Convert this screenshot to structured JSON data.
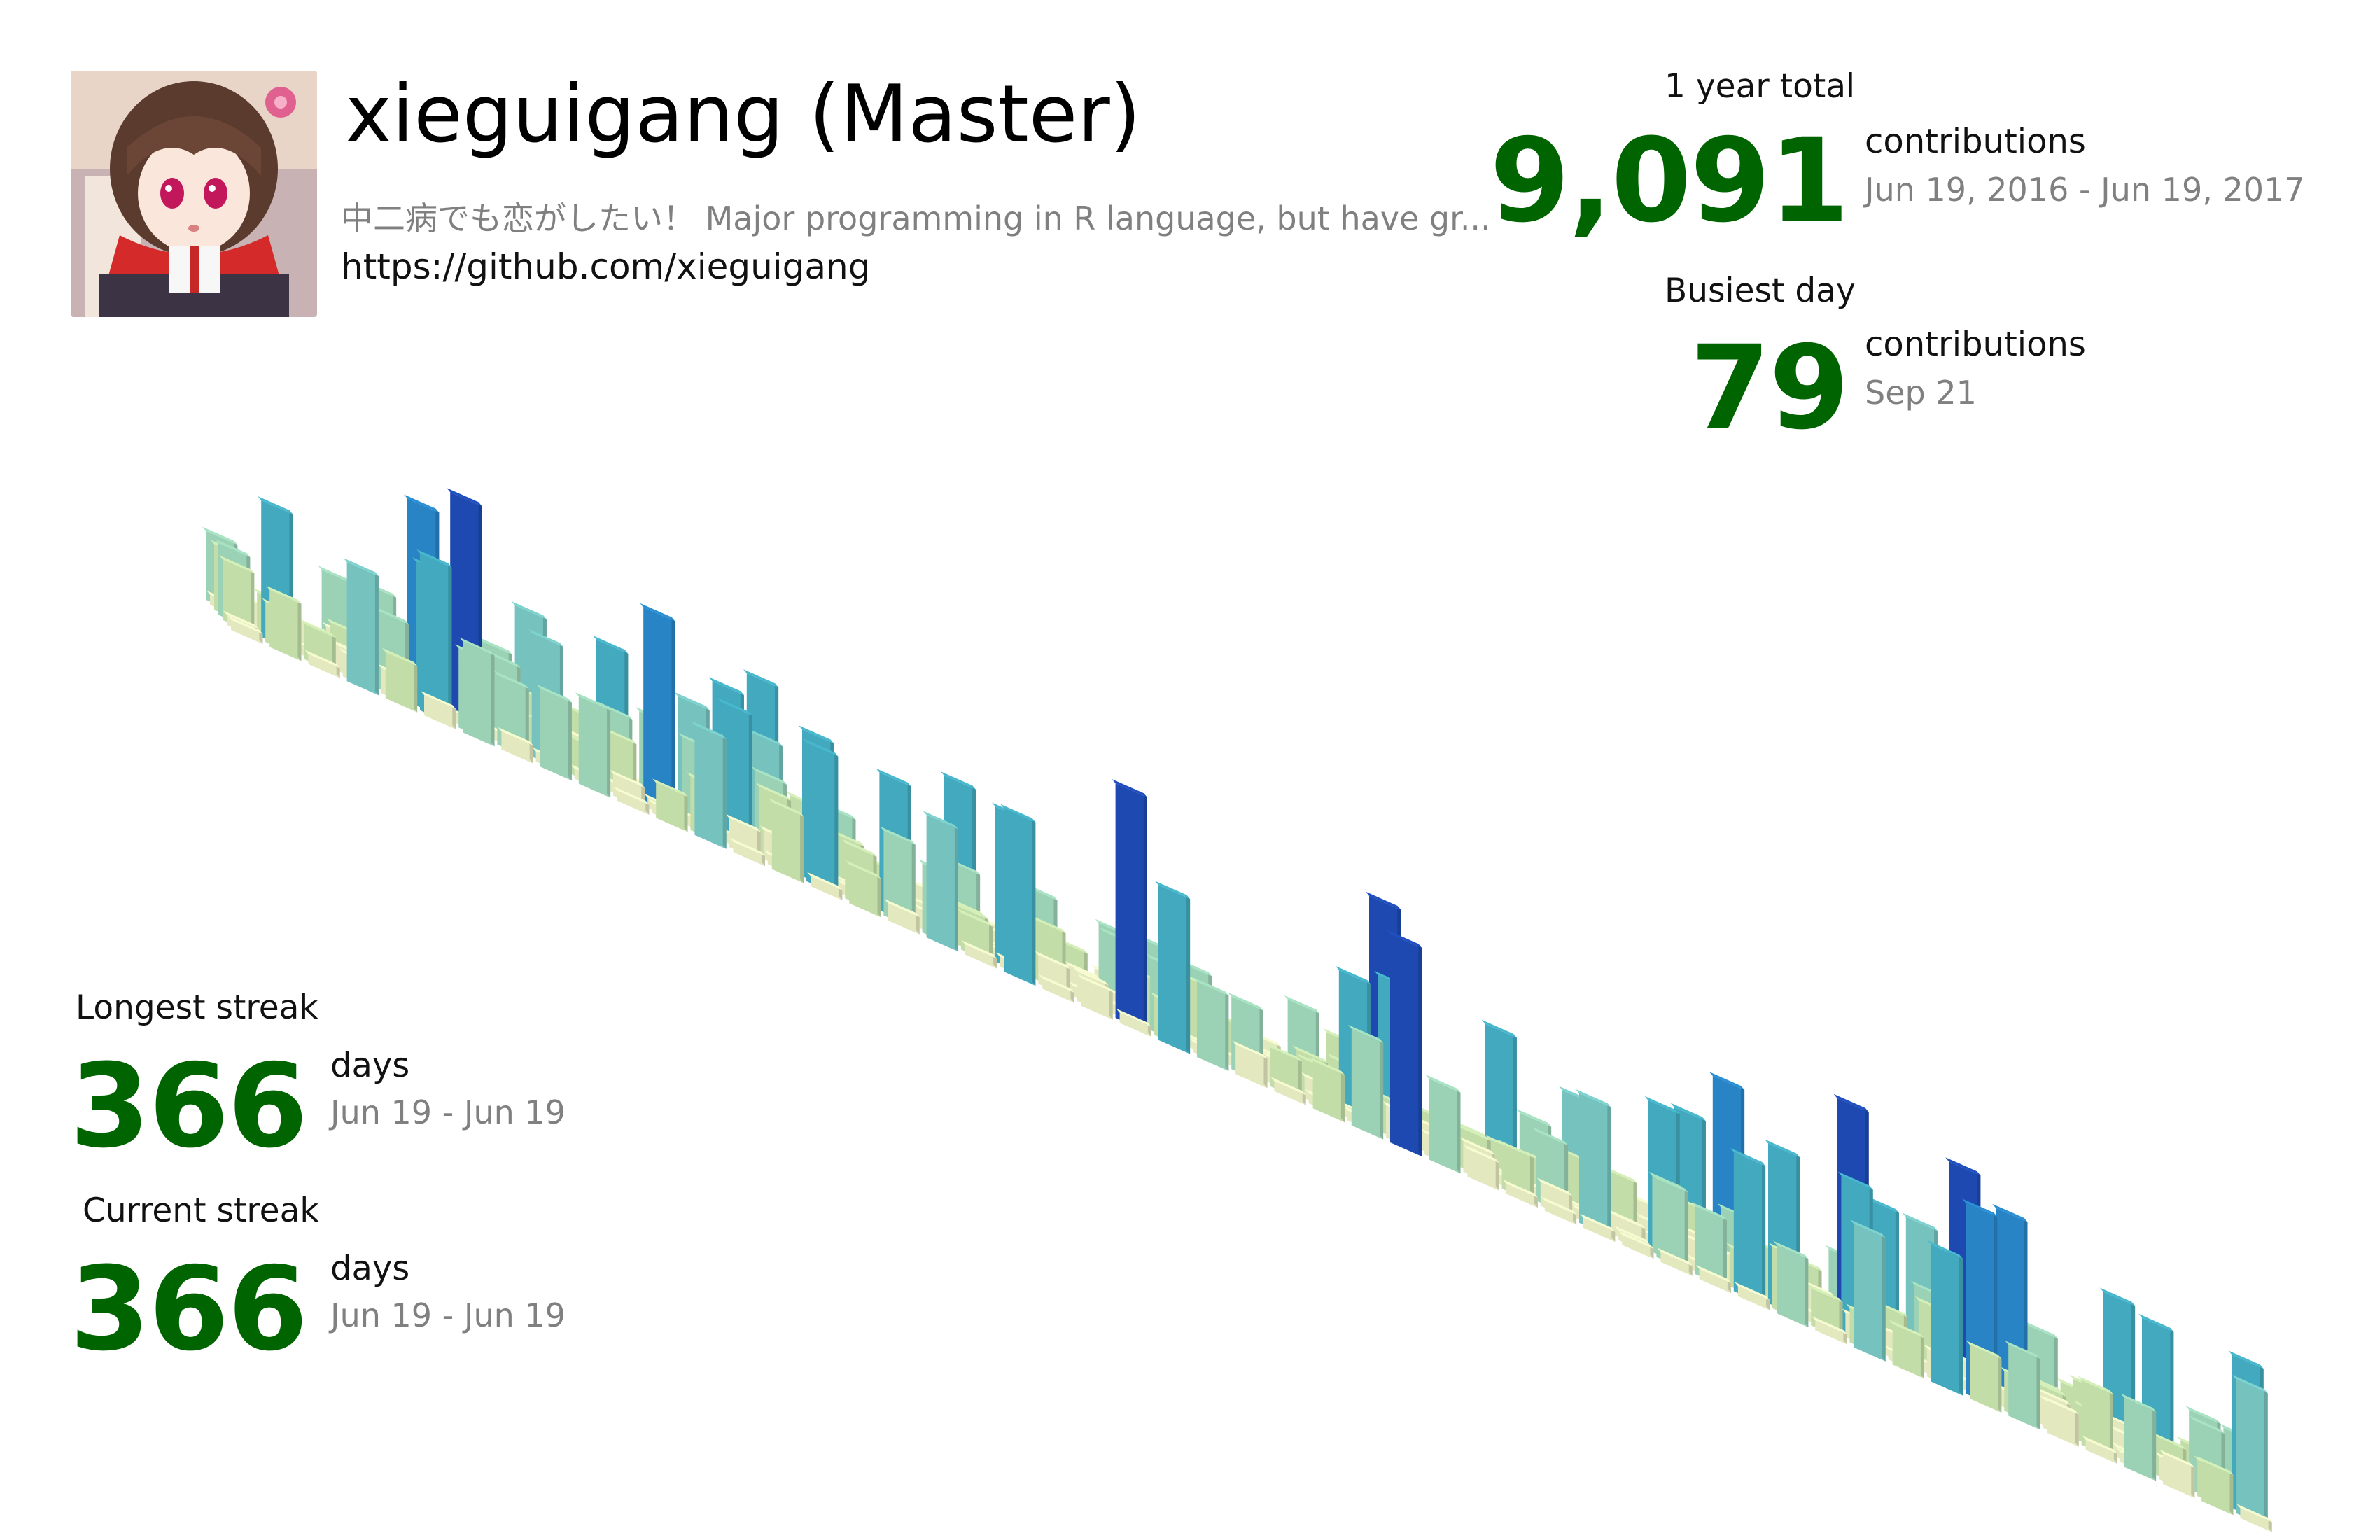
{
  "profile": {
    "name": "xieguigang (Master)",
    "bio": "中二病でも恋がしたい！ Major programming in R language, but have gr...",
    "url": "https://github.com/xieguigang"
  },
  "stats": {
    "year_total": {
      "label": "1 year total",
      "value": "9,091",
      "unit": "contributions",
      "range": "Jun 19, 2016 - Jun 19, 2017"
    },
    "busiest_day": {
      "label": "Busiest day",
      "value": "79",
      "unit": "contributions",
      "range": "Sep 21"
    },
    "longest_streak": {
      "label": "Longest streak",
      "value": "366",
      "unit": "days",
      "range": "Jun 19 - Jun 19"
    },
    "current_streak": {
      "label": "Current streak",
      "value": "366",
      "unit": "days",
      "range": "Jun 19 - Jun 19"
    }
  },
  "colors": {
    "stat_value": "#006400",
    "secondary_text": "#808080",
    "level_scale": [
      "#f7fcd0",
      "#d4f0b8",
      "#a8e3c4",
      "#7fd3cf",
      "#48b8cf",
      "#2b8fd6",
      "#1f4fc0"
    ]
  },
  "icons": {
    "avatar": "anime-girl-avatar"
  }
}
